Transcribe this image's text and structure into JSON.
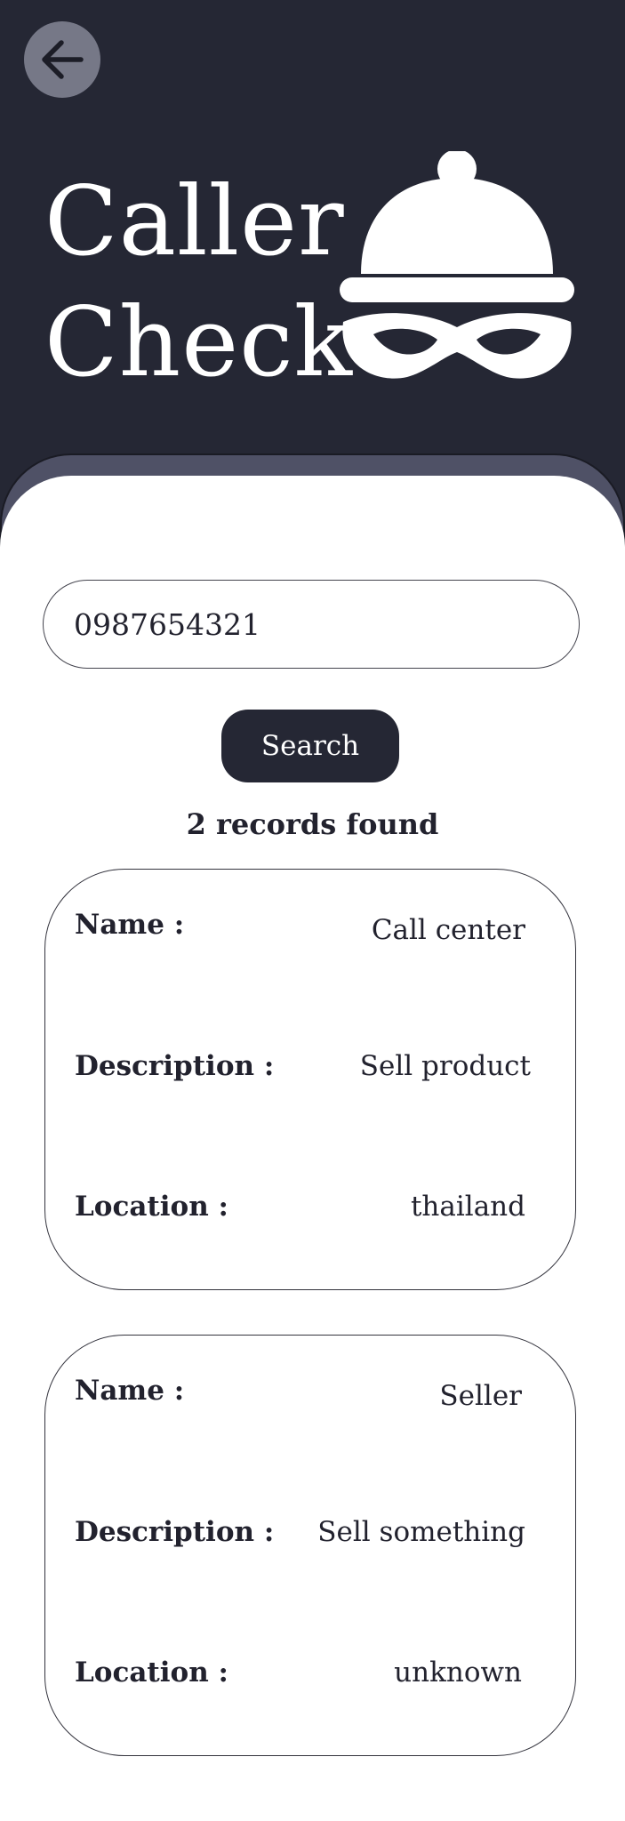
{
  "header": {
    "back_icon": "arrow-left-icon",
    "title_line1": "Caller",
    "title_line2": "Check",
    "logo_icon": "bandit-mask-icon",
    "background_color": "#252734"
  },
  "search": {
    "value": "0987654321",
    "button_label": "Search"
  },
  "results": {
    "summary": "2 records found",
    "records": [
      {
        "name_label": "Name :",
        "name_value": "Call center",
        "description_label": "Description :",
        "description_value": "Sell product",
        "location_label": "Location :",
        "location_value": "thailand"
      },
      {
        "name_label": "Name :",
        "name_value": "Seller",
        "description_label": "Description :",
        "description_value": "Sell something",
        "location_label": "Location :",
        "location_value": "unknown"
      }
    ]
  }
}
